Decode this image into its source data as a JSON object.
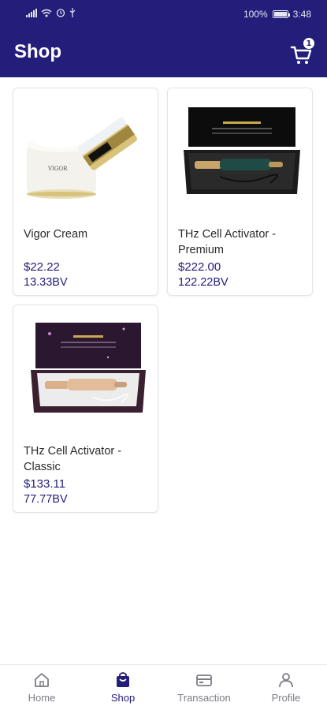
{
  "status_bar": {
    "battery": "100%",
    "time": "3:48"
  },
  "header": {
    "title": "Shop",
    "cart_count": "1"
  },
  "products": [
    {
      "name": "Vigor Cream",
      "price": "$22.22",
      "bv": "13.33BV"
    },
    {
      "name": "THz Cell Activator - Premium",
      "price": "$222.00",
      "bv": "122.22BV"
    },
    {
      "name": "THz Cell Activator - Classic",
      "price": "$133.11",
      "bv": "77.77BV"
    }
  ],
  "nav": {
    "items": [
      {
        "label": "Home",
        "icon": "home-icon"
      },
      {
        "label": "Shop",
        "icon": "shop-bag-icon"
      },
      {
        "label": "Transaction",
        "icon": "card-icon"
      },
      {
        "label": "Profile",
        "icon": "person-icon"
      }
    ],
    "active": "Shop"
  },
  "colors": {
    "brand": "#221e7a",
    "inactive": "#7c7c86"
  }
}
